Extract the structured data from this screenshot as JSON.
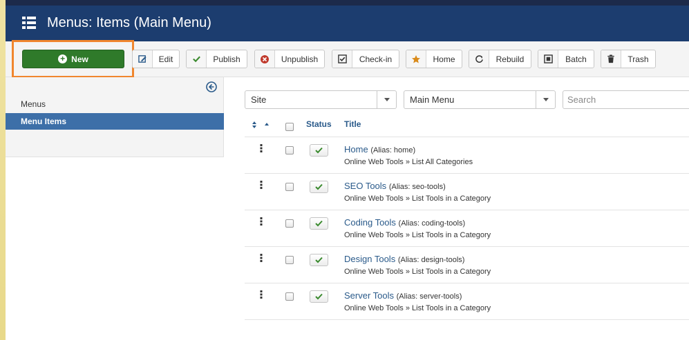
{
  "header": {
    "title": "Menus: Items (Main Menu)",
    "icon": "list-icon",
    "bg_color": "#1c3d6f"
  },
  "toolbar": {
    "new_label": "New",
    "buttons": [
      {
        "label": "Edit",
        "icon": "edit-icon"
      },
      {
        "label": "Publish",
        "icon": "check-icon"
      },
      {
        "label": "Unpublish",
        "icon": "unpublish-icon"
      },
      {
        "label": "Check-in",
        "icon": "checkin-icon"
      },
      {
        "label": "Home",
        "icon": "star-icon"
      },
      {
        "label": "Rebuild",
        "icon": "refresh-icon"
      },
      {
        "label": "Batch",
        "icon": "batch-icon"
      },
      {
        "label": "Trash",
        "icon": "trash-icon"
      }
    ],
    "new_color": "#2f7a2a",
    "highlight_color": "#f0862e"
  },
  "sidebar": {
    "items": [
      {
        "label": "Menus",
        "active": false
      },
      {
        "label": "Menu Items",
        "active": true
      }
    ],
    "active_color": "#3d6fa8"
  },
  "filters": {
    "client": "Site",
    "menu": "Main Menu",
    "search_placeholder": "Search"
  },
  "table": {
    "headers": {
      "status": "Status",
      "title": "Title"
    },
    "rows": [
      {
        "title": "Home",
        "alias": "(Alias: home)",
        "path": "Online Web Tools » List All Categories"
      },
      {
        "title": "SEO Tools",
        "alias": "(Alias: seo-tools)",
        "path": "Online Web Tools » List Tools in a Category"
      },
      {
        "title": "Coding Tools",
        "alias": "(Alias: coding-tools)",
        "path": "Online Web Tools » List Tools in a Category"
      },
      {
        "title": "Design Tools",
        "alias": "(Alias: design-tools)",
        "path": "Online Web Tools » List Tools in a Category"
      },
      {
        "title": "Server Tools",
        "alias": "(Alias: server-tools)",
        "path": "Online Web Tools » List Tools in a Category"
      }
    ]
  }
}
